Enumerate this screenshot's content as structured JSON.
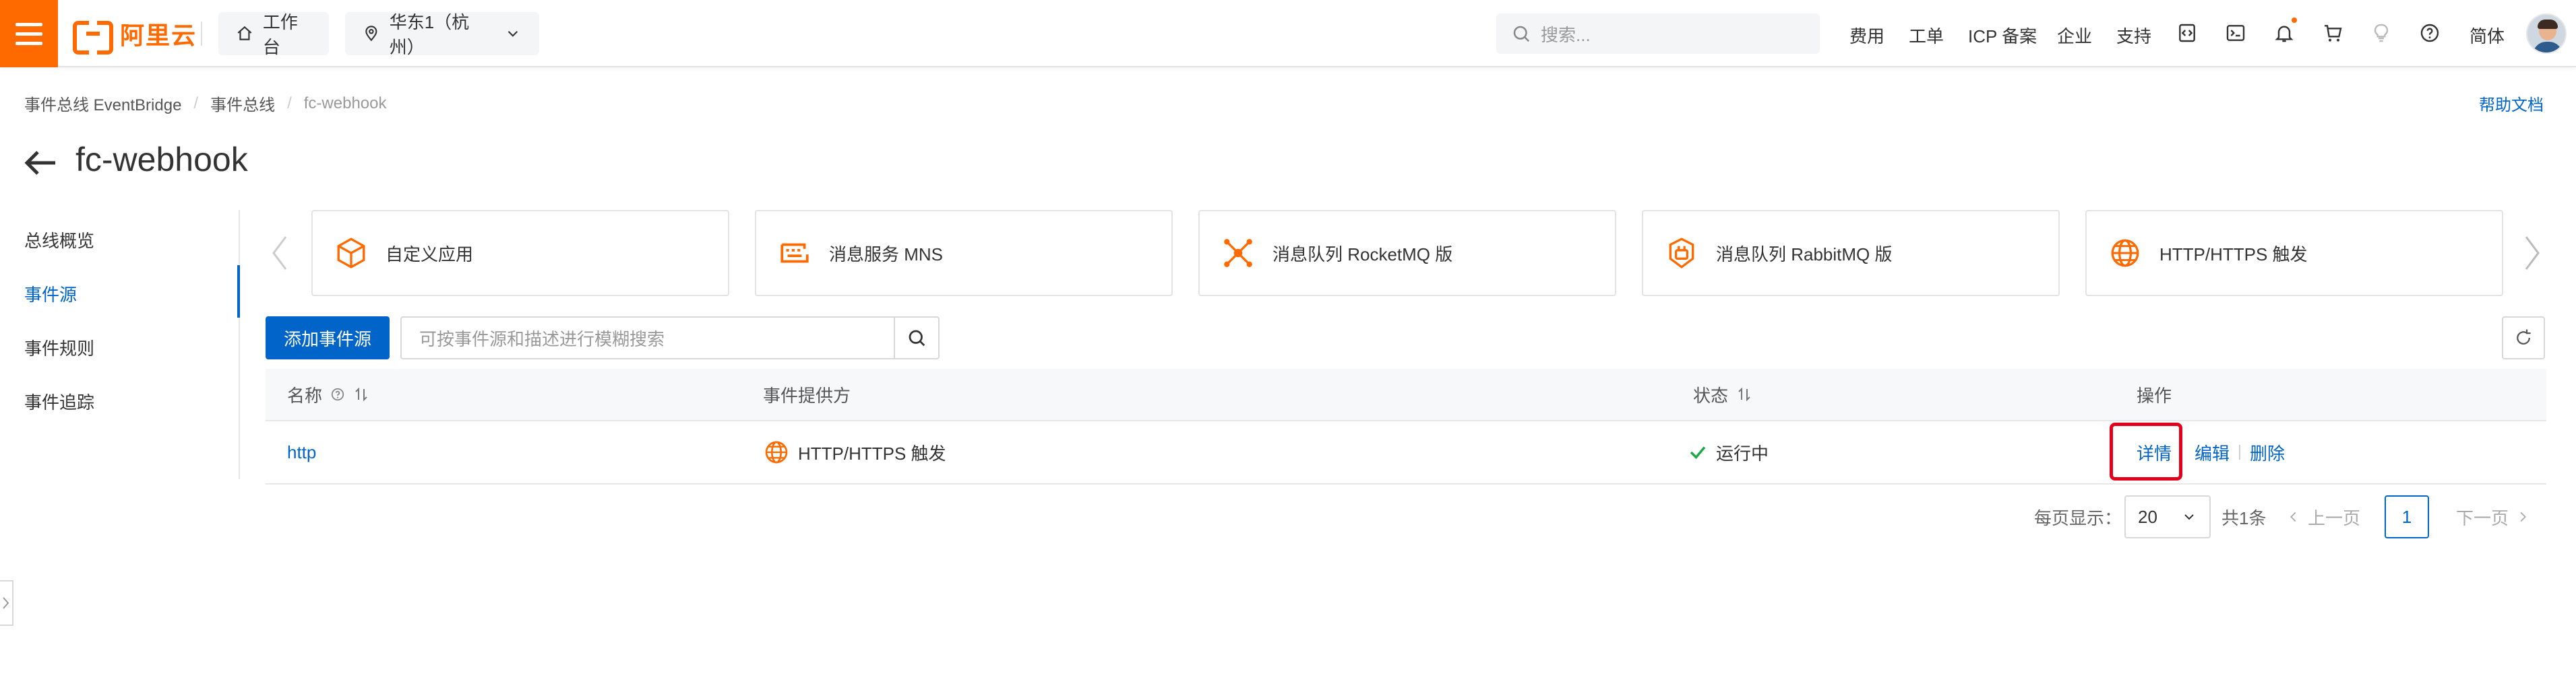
{
  "topbar": {
    "logo_text": "阿里云",
    "home_label": "工作台",
    "region_label": "华东1（杭州）",
    "search_placeholder": "搜索...",
    "links": [
      "费用",
      "工单",
      "ICP 备案",
      "企业",
      "支持"
    ],
    "language": "简体",
    "icons": [
      "code-icon",
      "terminal-icon",
      "bell-icon",
      "cart-icon",
      "bulb-icon",
      "help-icon"
    ]
  },
  "breadcrumb": {
    "items": [
      "事件总线 EventBridge",
      "事件总线",
      "fc-webhook"
    ],
    "help_doc": "帮助文档"
  },
  "page": {
    "title": "fc-webhook"
  },
  "sidenav": {
    "items": [
      "总线概览",
      "事件源",
      "事件规则",
      "事件追踪"
    ],
    "active_index": 1
  },
  "providers": [
    {
      "label": "自定义应用",
      "icon": "cube-icon"
    },
    {
      "label": "消息服务 MNS",
      "icon": "message-icon"
    },
    {
      "label": "消息队列 RocketMQ 版",
      "icon": "rocketmq-icon"
    },
    {
      "label": "消息队列 RabbitMQ 版",
      "icon": "rabbitmq-icon"
    },
    {
      "label": "HTTP/HTTPS 触发",
      "icon": "globe-icon"
    }
  ],
  "toolbar": {
    "add_label": "添加事件源",
    "search_placeholder": "可按事件源和描述进行模糊搜索"
  },
  "table": {
    "headers": {
      "name": "名称",
      "provider": "事件提供方",
      "status": "状态",
      "actions": "操作"
    },
    "rows": [
      {
        "name": "http",
        "provider": "HTTP/HTTPS 触发",
        "status": "运行中",
        "actions": {
          "detail": "详情",
          "edit": "编辑",
          "delete": "删除"
        }
      }
    ]
  },
  "pagination": {
    "page_size_label": "每页显示：",
    "page_size": "20",
    "total": "共1条",
    "prev": "上一页",
    "current": "1",
    "next": "下一页"
  },
  "colors": {
    "brand": "#ff6a00",
    "primary": "#0064c8",
    "success": "#1ea84a",
    "highlight": "#e2001a"
  }
}
